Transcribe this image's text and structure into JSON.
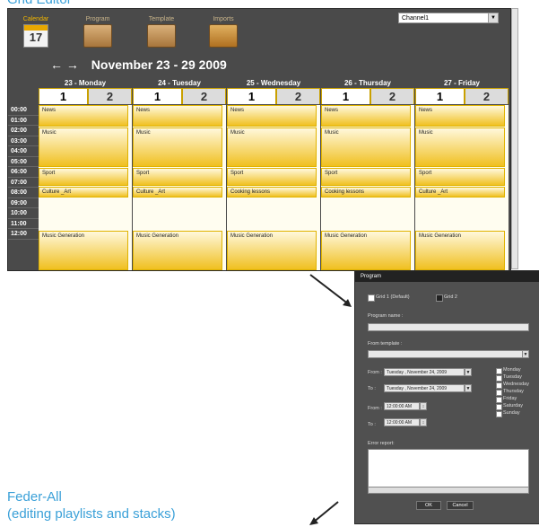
{
  "caption_top": "Grid Editor",
  "toolbar": {
    "calendar_label": "Calendar",
    "calendar_day": "17",
    "program_label": "Program",
    "template_label": "Template",
    "imports_label": "Imports"
  },
  "channel": {
    "selected": "Channel1"
  },
  "week": {
    "nav": "← →",
    "title": "November 23 - 29 2009"
  },
  "days": [
    {
      "label": "23 - Monday",
      "tab1": "1",
      "tab2": "2",
      "events": [
        "News",
        "Music",
        "Sport",
        "Culture _Art",
        "Music Generation"
      ]
    },
    {
      "label": "24 - Tuesday",
      "tab1": "1",
      "tab2": "2",
      "events": [
        "News",
        "Music",
        "Sport",
        "Culture _Art",
        "Music Generation"
      ]
    },
    {
      "label": "25 - Wednesday",
      "tab1": "1",
      "tab2": "2",
      "events": [
        "News",
        "Music",
        "Sport",
        "Cooking lessons",
        "Music Generation"
      ]
    },
    {
      "label": "26 - Thursday",
      "tab1": "1",
      "tab2": "2",
      "events": [
        "News",
        "Music",
        "Sport",
        "Cooking lessons",
        "Music Generation"
      ]
    },
    {
      "label": "27 - Friday",
      "tab1": "1",
      "tab2": "2",
      "events": [
        "News",
        "Music",
        "Sport",
        "Culture _Art",
        "Music Generation"
      ]
    }
  ],
  "hours": [
    "00:00",
    "01:00",
    "02:00",
    "03:00",
    "04:00",
    "05:00",
    "06:00",
    "07:00",
    "08:00",
    "09:00",
    "10:00",
    "11:00",
    "12:00"
  ],
  "dialog": {
    "title": "Program",
    "grid1": "Grid 1 (Default)",
    "grid2": "Grid 2",
    "program_name_label": "Program name :",
    "from_template_label": "From template :",
    "from_label": "From :",
    "to_label": "To :",
    "from_date": "Tuesday , November 24, 2009",
    "to_date": "Tuesday , November 24, 2009",
    "from_time": "12:00:00 AM",
    "to_time": "12:00:00 AM",
    "weekdays": [
      "Monday",
      "Tuesday",
      "Wednesday",
      "Thursday",
      "Friday",
      "Saturday",
      "Sunday"
    ],
    "error_label": "Error report:",
    "ok": "OK",
    "cancel": "Cancel"
  },
  "caption_bottom_1": "Feder-All",
  "caption_bottom_2": "(editing playlists and stacks)"
}
